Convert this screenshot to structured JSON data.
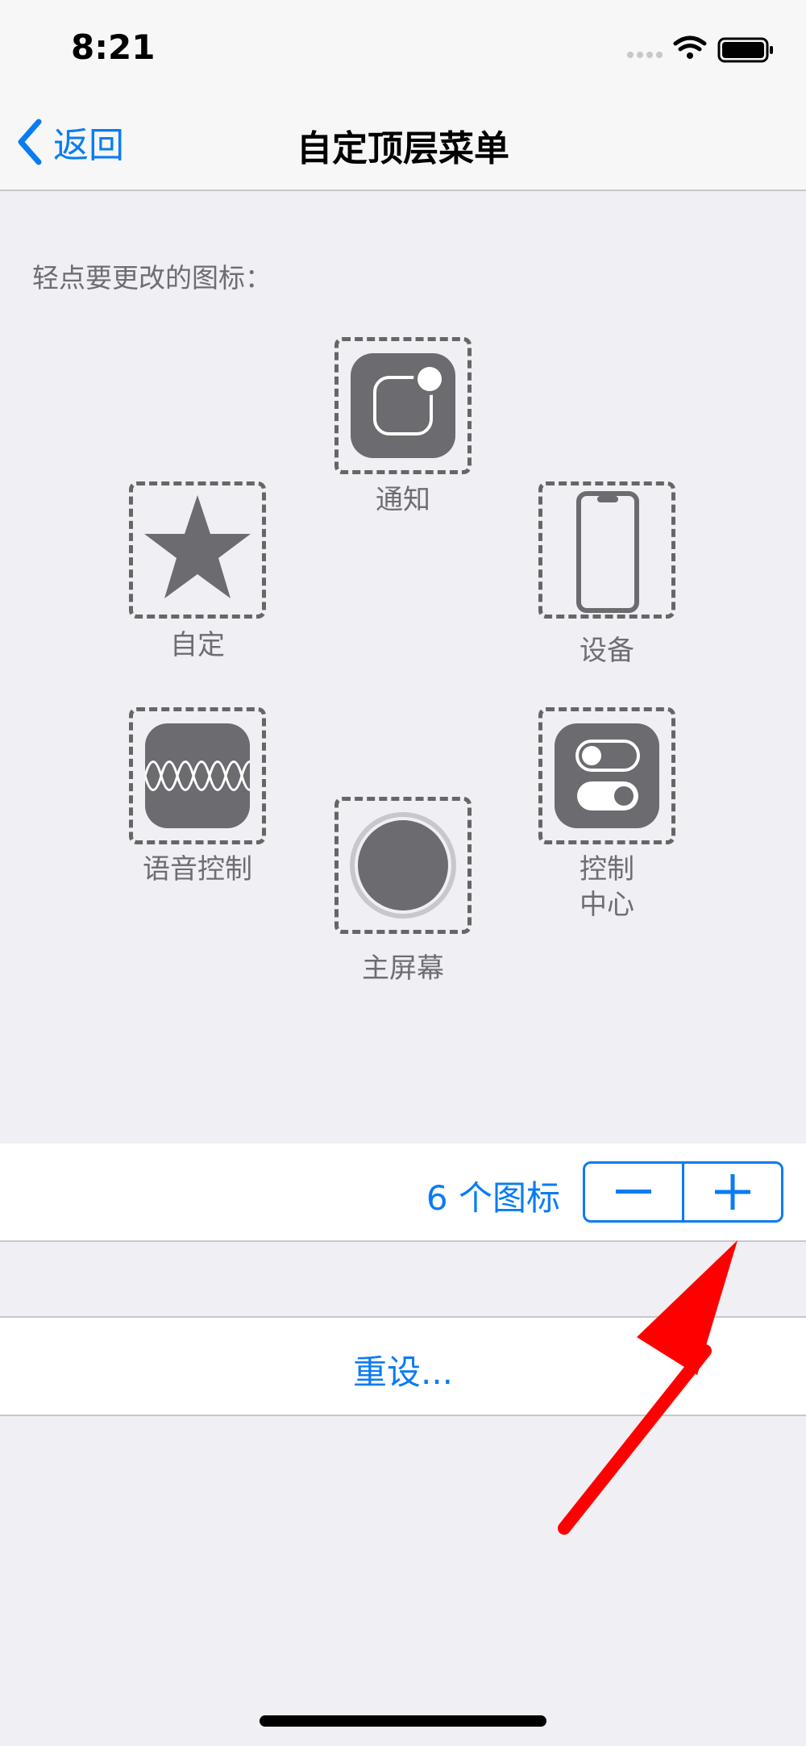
{
  "status": {
    "time": "8:21"
  },
  "nav": {
    "back_label": "返回",
    "title": "自定顶层菜单"
  },
  "instruction": "轻点要更改的图标：",
  "slots": {
    "notification": {
      "label": "通知",
      "icon": "notification-icon"
    },
    "custom": {
      "label": "自定",
      "icon": "star-icon"
    },
    "device": {
      "label": "设备",
      "icon": "device-icon"
    },
    "voice_control": {
      "label": "语音控制",
      "icon": "waveform-icon"
    },
    "control_center": {
      "label_line1": "控制",
      "label_line2": "中心",
      "icon": "toggle-switches-icon"
    },
    "home": {
      "label": "主屏幕",
      "icon": "home-button-icon"
    }
  },
  "counter": {
    "label": "6 个图标",
    "count": 6,
    "minus_icon": "minus-icon",
    "plus_icon": "plus-icon"
  },
  "reset_label": "重设...",
  "colors": {
    "accent": "#0a7cf3",
    "icon_gray": "#6b6b70",
    "annotation_arrow": "#ff0000",
    "background": "#efeff4"
  }
}
